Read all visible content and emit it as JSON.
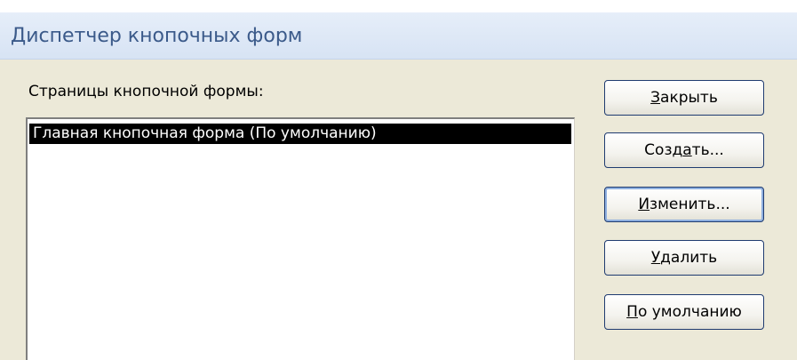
{
  "window": {
    "title": "Диспетчер кнопочных форм"
  },
  "pages_list": {
    "label": "Страницы кнопочной формы:",
    "items": [
      {
        "text": "Главная кнопочная форма (По умолчанию)",
        "selected": true
      }
    ]
  },
  "buttons": {
    "close": {
      "pre": "",
      "key": "З",
      "post": "акрыть"
    },
    "create": {
      "pre": "Созд",
      "key": "а",
      "post": "ть..."
    },
    "edit": {
      "pre": "",
      "key": "И",
      "post": "зменить..."
    },
    "delete": {
      "pre": "",
      "key": "У",
      "post": "далить"
    },
    "default": {
      "pre": "",
      "key": "П",
      "post": "о умолчанию"
    }
  },
  "colors": {
    "title_text": "#3b5a8a",
    "selection_bg": "#000000",
    "dialog_bg": "#ece9d8"
  }
}
